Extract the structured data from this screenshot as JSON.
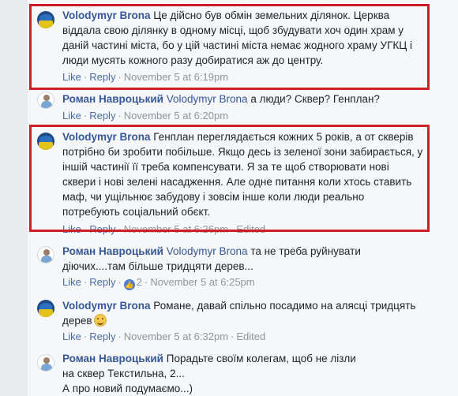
{
  "comments": [
    {
      "author": "Volodymyr Brona",
      "mention": "",
      "text": "Це дійсно був обмін земельних ділянок. Церква віддала свою ділянку в одному місці, щоб збудувати хоч один храм у даній частині міста, бо у цій частині міста немає жодного храму УГКЦ і люди мусять кожного разу добиратися аж до центру.",
      "like": "Like",
      "reply": "Reply",
      "time": "November 5 at 6:19pm",
      "edited": ""
    },
    {
      "author": "Роман Навроцький",
      "mention": "Volodymyr Brona",
      "text": "а люди? Сквер? Генплан?",
      "like": "Like",
      "reply": "Reply",
      "time": "November 5 at 6:20pm",
      "edited": ""
    },
    {
      "author": "Volodymyr Brona",
      "mention": "",
      "text": "Генплан переглядається кожних 5 років, а от скверів потрібно би зробити побільше. Якщо десь із зеленої зони забирається, у іншій частинії її треба компенсувати. Я за те щоб створювати нові сквери і нові зелені насадження. Але одне питання коли хтось ставить маф, чи ущільнює забудову і зовсім інше коли люди реально потребують соціальний обєкт.",
      "like": "Like",
      "reply": "Reply",
      "time": "November 5 at 6:26pm",
      "edited": "Edited"
    },
    {
      "author": "Роман Навроцький",
      "mention": "Volodymyr Brona",
      "text": "та не треба руйнувати діючих....там більше тридцяти дерев...",
      "like": "Like",
      "reply": "Reply",
      "reactions": "2",
      "time": "November 5 at 6:25pm",
      "edited": ""
    },
    {
      "author": "Volodymyr Brona",
      "mention": "",
      "text": "Романе, давай спільно посадимо на алясці тридцять дерев",
      "like": "Like",
      "reply": "Reply",
      "time": "November 5 at 6:32pm",
      "edited": "Edited"
    },
    {
      "author": "Роман Навроцький",
      "mention": "",
      "text": "Порадьте своїм колегам, щоб не лізли на сквер Текстильна, 2...",
      "text2": "А про новий подумаємо...)",
      "like": "",
      "reply": "",
      "time": "",
      "edited": ""
    }
  ],
  "colors": {
    "author_link": "#365899",
    "highlight_box": "#d01c24",
    "meta_text": "#90949c",
    "action_link": "#4b6ca8"
  },
  "icons": {
    "reaction": "like-reaction-icon",
    "emoji": "smiley-emoji-icon"
  }
}
